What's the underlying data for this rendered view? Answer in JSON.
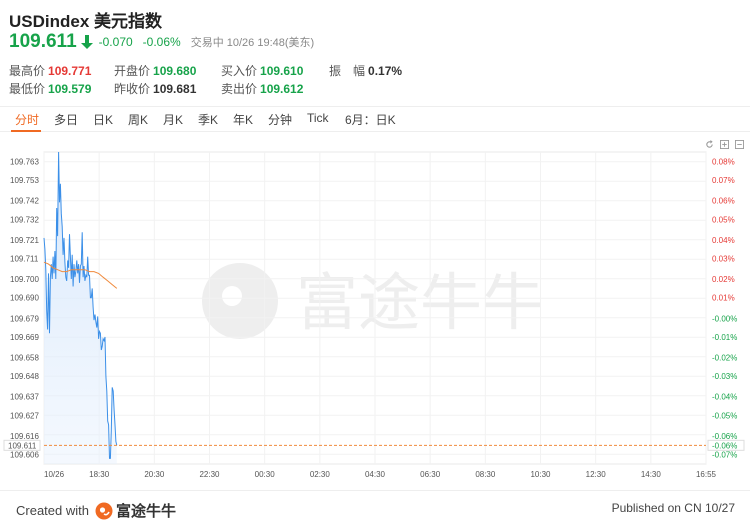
{
  "header": {
    "title": "USDindex 美元指数",
    "price": "109.611",
    "change": "-0.070",
    "change_pct": "-0.06%",
    "status": "交易中 10/26 19:48(美东)"
  },
  "stats": {
    "high_label": "最高价",
    "high_value": "109.771",
    "low_label": "最低价",
    "low_value": "109.579",
    "open_label": "开盘价",
    "open_value": "109.680",
    "prev_close_label": "昨收价",
    "prev_close_value": "109.681",
    "bid_label": "买入价",
    "bid_value": "109.610",
    "ask_label": "卖出价",
    "ask_value": "109.612",
    "amplitude_label": "振　幅",
    "amplitude_value": "0.17%"
  },
  "tabs": [
    "分时",
    "多日",
    "日K",
    "周K",
    "月K",
    "季K",
    "年K",
    "分钟",
    "Tick",
    "6月：日K"
  ],
  "active_tab": 0,
  "icons": {
    "refresh": "refresh-icon",
    "zoom_in": "zoom-in-icon",
    "zoom_out": "zoom-out-icon"
  },
  "colors": {
    "up": "#e53935",
    "down": "#17a34a",
    "accent": "#f06a23",
    "line": "#3b8fe8",
    "avg": "#f08a3c"
  },
  "chart_data": {
    "type": "line",
    "x_ticks": [
      "10/26",
      "18:30",
      "20:30",
      "22:30",
      "00:30",
      "02:30",
      "04:30",
      "06:30",
      "08:30",
      "10:30",
      "12:30",
      "14:30",
      "16:55"
    ],
    "x_range_minutes": [
      0,
      1455
    ],
    "y_ticks": [
      109.763,
      109.753,
      109.742,
      109.732,
      109.721,
      109.711,
      109.7,
      109.69,
      109.679,
      109.669,
      109.658,
      109.648,
      109.637,
      109.627,
      109.616,
      109.606
    ],
    "pct_ticks": [
      "0.08%",
      "0.07%",
      "0.06%",
      "0.05%",
      "0.04%",
      "0.03%",
      "0.02%",
      "0.01%",
      "-0.00%",
      "-0.01%",
      "-0.02%",
      "-0.03%",
      "-0.04%",
      "-0.05%",
      "-0.06%",
      "-0.07%"
    ],
    "ylim": [
      109.601,
      109.768
    ],
    "prev_close": 109.681,
    "current": 109.611,
    "current_label": "109.611",
    "current_pct": "-0.06%",
    "series": [
      {
        "kind": "price",
        "x": [
          0,
          2,
          4,
          6,
          8,
          10,
          12,
          14,
          16,
          18,
          20,
          22,
          24,
          26,
          28,
          30,
          32,
          34,
          36,
          38,
          40,
          42,
          44,
          46,
          48,
          50,
          52,
          54,
          56,
          58,
          60,
          62,
          64,
          66,
          68,
          70,
          72,
          74,
          76,
          78,
          80,
          82,
          84,
          86,
          88,
          90,
          92,
          94,
          96,
          98,
          100,
          102,
          104,
          106,
          108,
          110,
          112,
          114,
          116,
          118,
          120,
          122,
          124,
          126,
          128,
          130,
          132,
          134,
          136,
          138,
          140,
          142,
          144,
          146,
          148,
          150,
          152,
          154,
          156,
          158,
          160
        ],
        "y": [
          109.722,
          109.716,
          109.705,
          109.683,
          109.673,
          109.703,
          109.671,
          109.701,
          109.708,
          109.7,
          109.712,
          109.703,
          109.715,
          109.7,
          109.738,
          109.723,
          109.768,
          109.741,
          109.751,
          109.735,
          109.728,
          109.713,
          109.722,
          109.709,
          109.701,
          109.699,
          109.71,
          109.706,
          109.724,
          109.712,
          109.7,
          109.713,
          109.696,
          109.708,
          109.701,
          109.704,
          109.71,
          109.703,
          109.708,
          109.698,
          109.707,
          109.708,
          109.725,
          109.701,
          109.707,
          109.699,
          109.702,
          109.701,
          109.712,
          109.702,
          109.702,
          109.69,
          109.69,
          109.695,
          109.685,
          109.678,
          109.681,
          109.677,
          109.674,
          109.68,
          109.668,
          109.672,
          109.671,
          109.662,
          109.664,
          109.668,
          109.667,
          109.669,
          109.648,
          109.64,
          109.624,
          109.622,
          109.604,
          109.604,
          109.619,
          109.642,
          109.64,
          109.63,
          109.622,
          109.613,
          109.611
        ]
      },
      {
        "kind": "average",
        "x": [
          0,
          10,
          20,
          30,
          40,
          50,
          60,
          70,
          80,
          90,
          100,
          110,
          120,
          130,
          140,
          150,
          160
        ],
        "y": [
          109.709,
          109.708,
          109.706,
          109.705,
          109.704,
          109.704,
          109.705,
          109.705,
          109.705,
          109.705,
          109.704,
          109.704,
          109.703,
          109.701,
          109.699,
          109.697,
          109.695
        ]
      }
    ],
    "watermark": "富途牛牛"
  },
  "footer": {
    "created_with": "Created with",
    "brand": "富途牛牛",
    "published": "Published on CN 10/27"
  }
}
